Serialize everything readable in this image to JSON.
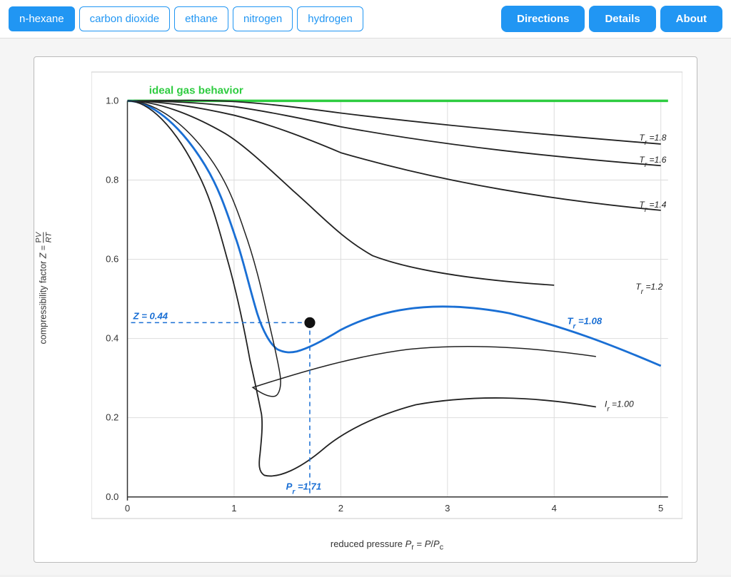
{
  "header": {
    "tabs": [
      {
        "id": "n-hexane",
        "label": "n-hexane",
        "active": true
      },
      {
        "id": "carbon-dioxide",
        "label": "carbon dioxide",
        "active": false
      },
      {
        "id": "ethane",
        "label": "ethane",
        "active": false
      },
      {
        "id": "nitrogen",
        "label": "nitrogen",
        "active": false
      },
      {
        "id": "hydrogen",
        "label": "hydrogen",
        "active": false
      }
    ],
    "buttons": [
      {
        "id": "directions",
        "label": "Directions"
      },
      {
        "id": "details",
        "label": "Details"
      },
      {
        "id": "about",
        "label": "About"
      }
    ]
  },
  "chart": {
    "y_axis_label": "compressibility factor Z = PV / RT",
    "x_axis_label": "reduced pressure Pr = P/Pc",
    "ideal_gas_label": "ideal gas behavior",
    "point_z": "Z = 0.44",
    "point_pr": "Pr = 1.71",
    "tr_labels": [
      "Tr = 1.8",
      "Tr = 1.6",
      "Tr = 1.4",
      "Tr = 1.2",
      "Tr = 1.08",
      "Tr = 1.00"
    ]
  }
}
